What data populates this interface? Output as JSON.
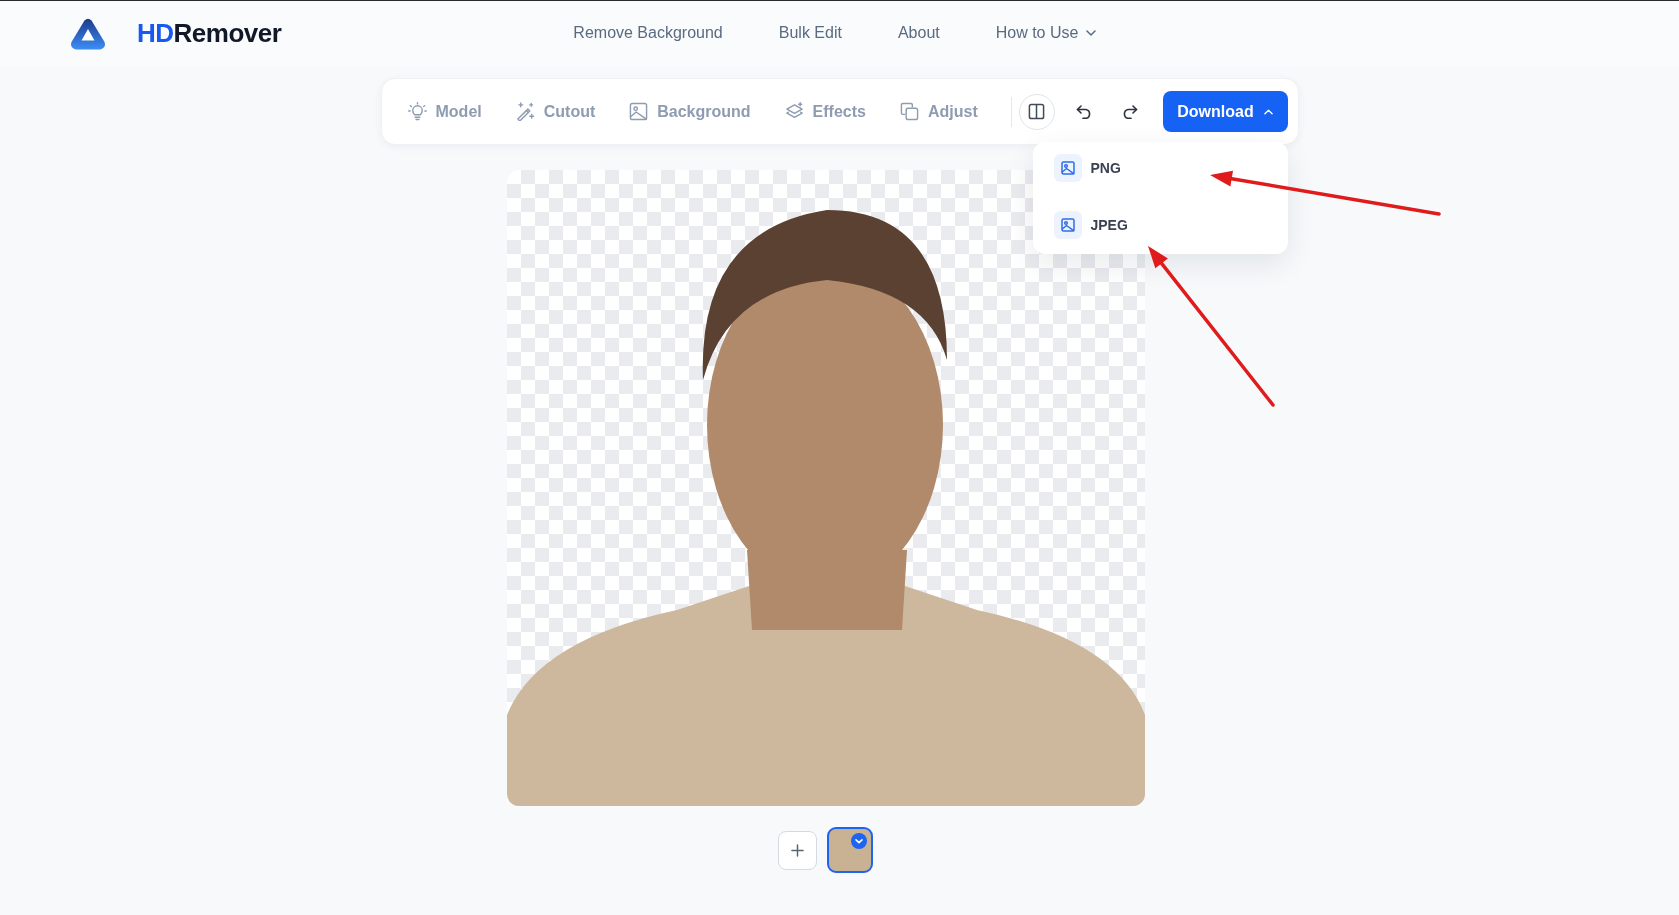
{
  "header": {
    "logo": {
      "accent": "HD",
      "name": "Remover"
    },
    "nav": [
      {
        "label": "Remove Background",
        "kind": "link"
      },
      {
        "label": "Bulk Edit",
        "kind": "link"
      },
      {
        "label": "About",
        "kind": "link"
      },
      {
        "label": "How to Use",
        "kind": "dropdown"
      }
    ]
  },
  "toolbar": {
    "tools": [
      {
        "label": "Model"
      },
      {
        "label": "Cutout"
      },
      {
        "label": "Background"
      },
      {
        "label": "Effects"
      },
      {
        "label": "Adjust"
      }
    ],
    "download": {
      "label": "Download",
      "expanded": true,
      "options": [
        {
          "label": "PNG"
        },
        {
          "label": "JPEG"
        }
      ]
    }
  },
  "thumbnails": [
    {
      "selected": true
    }
  ]
}
